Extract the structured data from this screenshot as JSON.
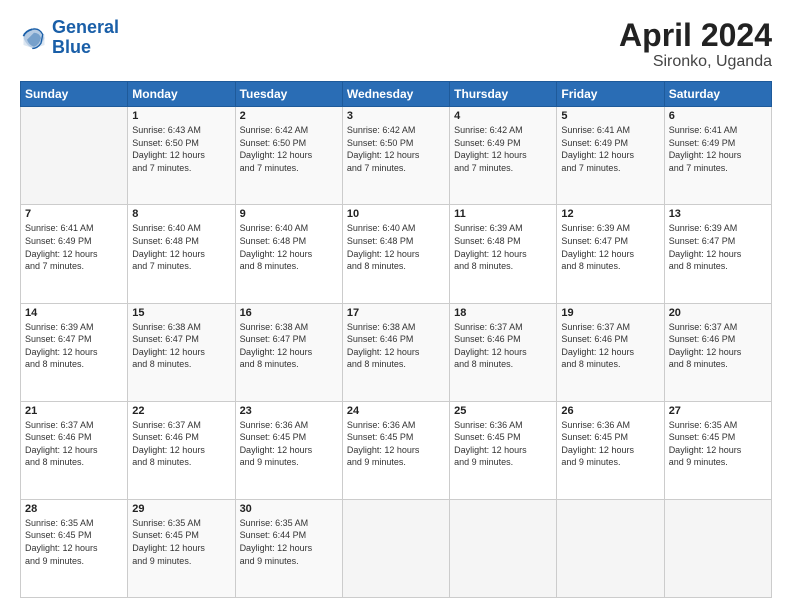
{
  "header": {
    "logo_line1": "General",
    "logo_line2": "Blue",
    "title": "April 2024",
    "subtitle": "Sironko, Uganda"
  },
  "calendar": {
    "days_of_week": [
      "Sunday",
      "Monday",
      "Tuesday",
      "Wednesday",
      "Thursday",
      "Friday",
      "Saturday"
    ],
    "weeks": [
      [
        {
          "day": "",
          "sunrise": "",
          "sunset": "",
          "daylight": ""
        },
        {
          "day": "1",
          "sunrise": "Sunrise: 6:43 AM",
          "sunset": "Sunset: 6:50 PM",
          "daylight": "Daylight: 12 hours and 7 minutes."
        },
        {
          "day": "2",
          "sunrise": "Sunrise: 6:42 AM",
          "sunset": "Sunset: 6:50 PM",
          "daylight": "Daylight: 12 hours and 7 minutes."
        },
        {
          "day": "3",
          "sunrise": "Sunrise: 6:42 AM",
          "sunset": "Sunset: 6:50 PM",
          "daylight": "Daylight: 12 hours and 7 minutes."
        },
        {
          "day": "4",
          "sunrise": "Sunrise: 6:42 AM",
          "sunset": "Sunset: 6:49 PM",
          "daylight": "Daylight: 12 hours and 7 minutes."
        },
        {
          "day": "5",
          "sunrise": "Sunrise: 6:41 AM",
          "sunset": "Sunset: 6:49 PM",
          "daylight": "Daylight: 12 hours and 7 minutes."
        },
        {
          "day": "6",
          "sunrise": "Sunrise: 6:41 AM",
          "sunset": "Sunset: 6:49 PM",
          "daylight": "Daylight: 12 hours and 7 minutes."
        }
      ],
      [
        {
          "day": "7",
          "sunrise": "Sunrise: 6:41 AM",
          "sunset": "Sunset: 6:49 PM",
          "daylight": "Daylight: 12 hours and 7 minutes."
        },
        {
          "day": "8",
          "sunrise": "Sunrise: 6:40 AM",
          "sunset": "Sunset: 6:48 PM",
          "daylight": "Daylight: 12 hours and 7 minutes."
        },
        {
          "day": "9",
          "sunrise": "Sunrise: 6:40 AM",
          "sunset": "Sunset: 6:48 PM",
          "daylight": "Daylight: 12 hours and 8 minutes."
        },
        {
          "day": "10",
          "sunrise": "Sunrise: 6:40 AM",
          "sunset": "Sunset: 6:48 PM",
          "daylight": "Daylight: 12 hours and 8 minutes."
        },
        {
          "day": "11",
          "sunrise": "Sunrise: 6:39 AM",
          "sunset": "Sunset: 6:48 PM",
          "daylight": "Daylight: 12 hours and 8 minutes."
        },
        {
          "day": "12",
          "sunrise": "Sunrise: 6:39 AM",
          "sunset": "Sunset: 6:47 PM",
          "daylight": "Daylight: 12 hours and 8 minutes."
        },
        {
          "day": "13",
          "sunrise": "Sunrise: 6:39 AM",
          "sunset": "Sunset: 6:47 PM",
          "daylight": "Daylight: 12 hours and 8 minutes."
        }
      ],
      [
        {
          "day": "14",
          "sunrise": "Sunrise: 6:39 AM",
          "sunset": "Sunset: 6:47 PM",
          "daylight": "Daylight: 12 hours and 8 minutes."
        },
        {
          "day": "15",
          "sunrise": "Sunrise: 6:38 AM",
          "sunset": "Sunset: 6:47 PM",
          "daylight": "Daylight: 12 hours and 8 minutes."
        },
        {
          "day": "16",
          "sunrise": "Sunrise: 6:38 AM",
          "sunset": "Sunset: 6:47 PM",
          "daylight": "Daylight: 12 hours and 8 minutes."
        },
        {
          "day": "17",
          "sunrise": "Sunrise: 6:38 AM",
          "sunset": "Sunset: 6:46 PM",
          "daylight": "Daylight: 12 hours and 8 minutes."
        },
        {
          "day": "18",
          "sunrise": "Sunrise: 6:37 AM",
          "sunset": "Sunset: 6:46 PM",
          "daylight": "Daylight: 12 hours and 8 minutes."
        },
        {
          "day": "19",
          "sunrise": "Sunrise: 6:37 AM",
          "sunset": "Sunset: 6:46 PM",
          "daylight": "Daylight: 12 hours and 8 minutes."
        },
        {
          "day": "20",
          "sunrise": "Sunrise: 6:37 AM",
          "sunset": "Sunset: 6:46 PM",
          "daylight": "Daylight: 12 hours and 8 minutes."
        }
      ],
      [
        {
          "day": "21",
          "sunrise": "Sunrise: 6:37 AM",
          "sunset": "Sunset: 6:46 PM",
          "daylight": "Daylight: 12 hours and 8 minutes."
        },
        {
          "day": "22",
          "sunrise": "Sunrise: 6:37 AM",
          "sunset": "Sunset: 6:46 PM",
          "daylight": "Daylight: 12 hours and 8 minutes."
        },
        {
          "day": "23",
          "sunrise": "Sunrise: 6:36 AM",
          "sunset": "Sunset: 6:45 PM",
          "daylight": "Daylight: 12 hours and 9 minutes."
        },
        {
          "day": "24",
          "sunrise": "Sunrise: 6:36 AM",
          "sunset": "Sunset: 6:45 PM",
          "daylight": "Daylight: 12 hours and 9 minutes."
        },
        {
          "day": "25",
          "sunrise": "Sunrise: 6:36 AM",
          "sunset": "Sunset: 6:45 PM",
          "daylight": "Daylight: 12 hours and 9 minutes."
        },
        {
          "day": "26",
          "sunrise": "Sunrise: 6:36 AM",
          "sunset": "Sunset: 6:45 PM",
          "daylight": "Daylight: 12 hours and 9 minutes."
        },
        {
          "day": "27",
          "sunrise": "Sunrise: 6:35 AM",
          "sunset": "Sunset: 6:45 PM",
          "daylight": "Daylight: 12 hours and 9 minutes."
        }
      ],
      [
        {
          "day": "28",
          "sunrise": "Sunrise: 6:35 AM",
          "sunset": "Sunset: 6:45 PM",
          "daylight": "Daylight: 12 hours and 9 minutes."
        },
        {
          "day": "29",
          "sunrise": "Sunrise: 6:35 AM",
          "sunset": "Sunset: 6:45 PM",
          "daylight": "Daylight: 12 hours and 9 minutes."
        },
        {
          "day": "30",
          "sunrise": "Sunrise: 6:35 AM",
          "sunset": "Sunset: 6:44 PM",
          "daylight": "Daylight: 12 hours and 9 minutes."
        },
        {
          "day": "",
          "sunrise": "",
          "sunset": "",
          "daylight": ""
        },
        {
          "day": "",
          "sunrise": "",
          "sunset": "",
          "daylight": ""
        },
        {
          "day": "",
          "sunrise": "",
          "sunset": "",
          "daylight": ""
        },
        {
          "day": "",
          "sunrise": "",
          "sunset": "",
          "daylight": ""
        }
      ]
    ]
  }
}
